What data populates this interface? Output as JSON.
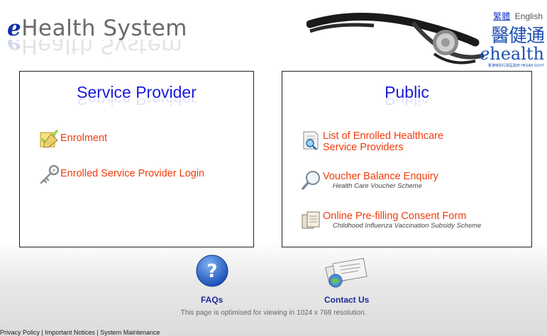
{
  "header": {
    "logo_e": "e",
    "logo_rest": "Health System",
    "lang_zh": "繁體",
    "lang_en": "English",
    "brand_zh": "醫健通",
    "brand_en_e": "e",
    "brand_en_rest": "health",
    "brand_sub": "香港特別行政區政府  HKSAR GOVT"
  },
  "service_provider": {
    "title": "Service Provider",
    "items": [
      {
        "label": "Enrolment",
        "icon": "pencil-check-icon"
      },
      {
        "label": "Enrolled Service Provider Login",
        "icon": "key-icon"
      }
    ]
  },
  "public": {
    "title": "Public",
    "items": [
      {
        "label": "List of Enrolled Healthcare Service Providers",
        "sub": "",
        "icon": "document-search-icon"
      },
      {
        "label": "Voucher Balance Enquiry",
        "sub": "Health Care Voucher Scheme",
        "icon": "magnifier-icon"
      },
      {
        "label": "Online Pre-filling Consent Form",
        "sub": "Childhood Influenza Vaccination Subsidy Scheme",
        "icon": "forms-icon"
      }
    ]
  },
  "footer": {
    "faqs": "FAQs",
    "contact": "Contact Us",
    "resolution": "This page is optimised for viewing in 1024 x 768 resolution.",
    "links": [
      "Privacy Policy",
      "Important Notices",
      "System Maintenance"
    ],
    "separator": "|"
  },
  "colors": {
    "title_blue": "#1a1ad8",
    "link_orange": "#f03c0c",
    "footer_blue": "#1a2a9a"
  }
}
